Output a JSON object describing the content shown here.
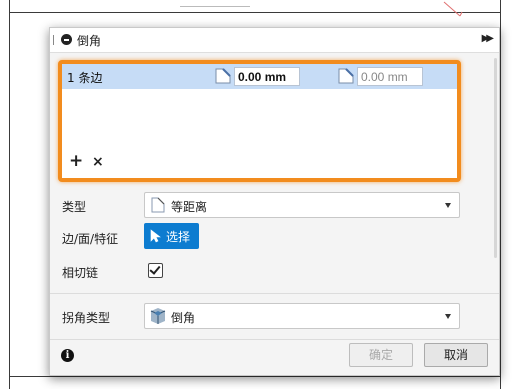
{
  "dialog": {
    "title": "倒角",
    "title_icon": "minus-circle-icon",
    "expand_icon": "double-chevron-right-icon"
  },
  "edge_list": {
    "row_label": "1 条边",
    "distance1": "0.00 mm",
    "distance2": "0.00 mm",
    "add_icon": "+",
    "remove_icon": "×"
  },
  "form": {
    "type_label": "类型",
    "type_value": "等距离",
    "edge_label": "边/面/特征",
    "select_button": "选择",
    "tangent_label": "相切链",
    "tangent_checked": true,
    "corner_label": "拐角类型",
    "corner_value": "倒角"
  },
  "footer": {
    "info_icon": "i",
    "ok": "确定",
    "cancel": "取消"
  },
  "colors": {
    "highlight_border": "#f28c1e",
    "row_selected": "#c6dcf6",
    "primary_button": "#0d7cd0"
  }
}
